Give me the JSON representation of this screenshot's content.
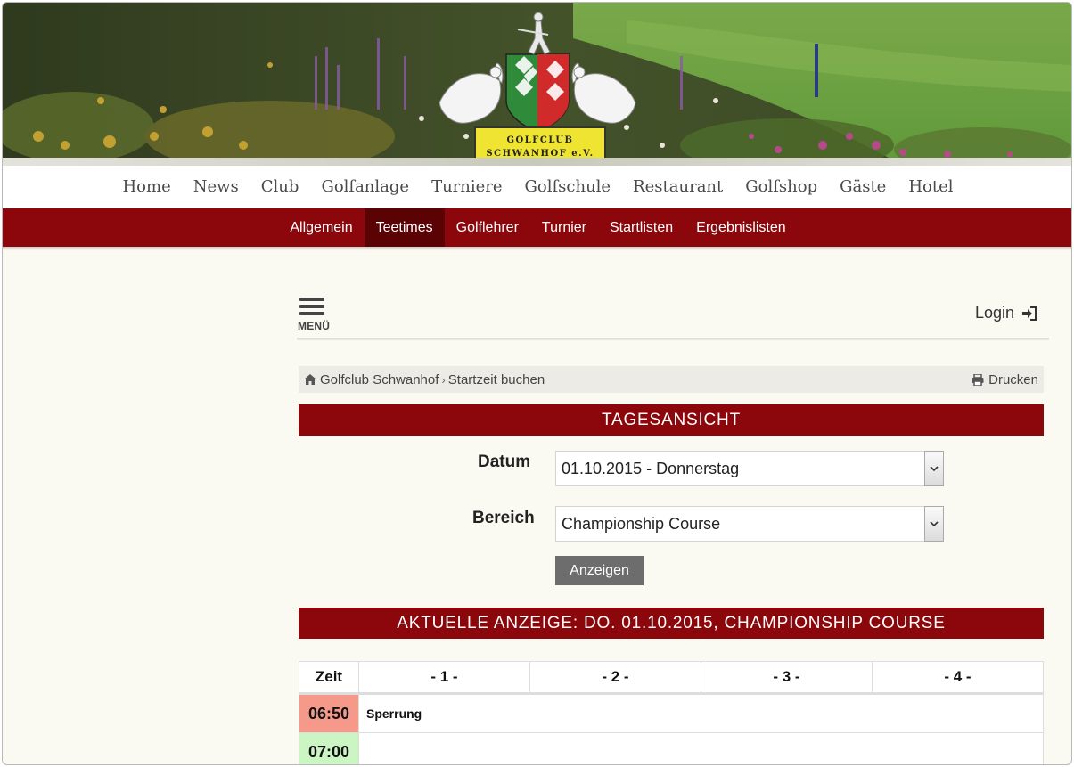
{
  "brand": {
    "logo_line1": "GOLFCLUB",
    "logo_line2": "SCHWANHOF e.V."
  },
  "main_nav": [
    "Home",
    "News",
    "Club",
    "Golfanlage",
    "Turniere",
    "Golfschule",
    "Restaurant",
    "Golfshop",
    "Gäste",
    "Hotel"
  ],
  "sub_nav": {
    "items": [
      "Allgemein",
      "Teetimes",
      "Golflehrer",
      "Turnier",
      "Startlisten",
      "Ergebnislisten"
    ],
    "active": "Teetimes"
  },
  "toolbar": {
    "menu_label": "MENÜ",
    "login_label": "Login"
  },
  "breadcrumb": {
    "home": "Golfclub Schwanhof",
    "current": "Startzeit buchen",
    "print_label": "Drucken"
  },
  "form": {
    "title": "TAGESANSICHT",
    "date_label": "Datum",
    "date_value": "01.10.2015 - Donnerstag",
    "area_label": "Bereich",
    "area_value": "Championship Course",
    "submit_label": "Anzeigen"
  },
  "display_title": "AKTUELLE ANZEIGE: DO. 01.10.2015, CHAMPIONSHIP COURSE",
  "tee_table": {
    "headers": [
      "Zeit",
      "- 1 -",
      "- 2 -",
      "- 3 -",
      "- 4 -"
    ],
    "rows": [
      {
        "time": "06:50",
        "note": "Sperrung",
        "status": "blocked"
      },
      {
        "time": "07:00",
        "note": "",
        "status": "free"
      }
    ]
  },
  "colors": {
    "brand_red": "#8b070b",
    "active_tab": "#5a0204",
    "blocked": "#f59a8a",
    "free": "#ccf5c4"
  }
}
